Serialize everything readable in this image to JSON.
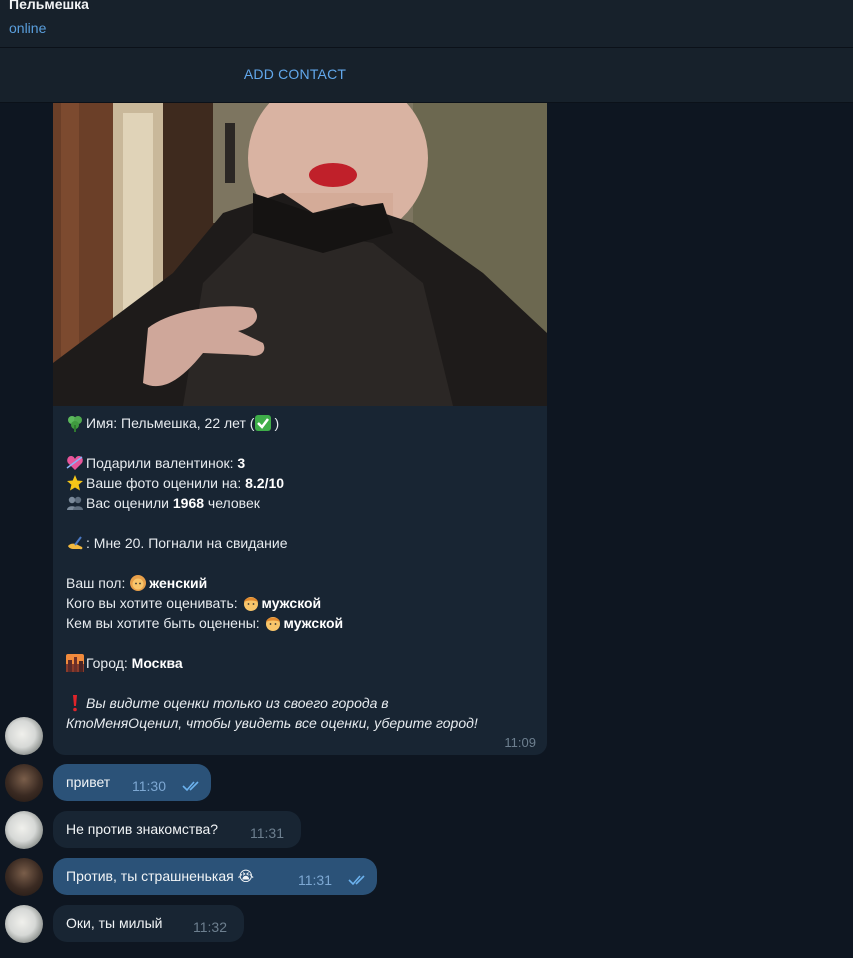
{
  "header": {
    "name": "Пельмешка",
    "status": "online"
  },
  "add_contact": "ADD CONTACT",
  "card": {
    "line_name": "Имя: Пельмешка, 22 лет (",
    "line_name_end": ")",
    "valentines_label": "Подарили валентинок: ",
    "valentines_value": "3",
    "rating_label": "Ваше фото оценили на: ",
    "rating_value": "8.2/10",
    "raters_prefix": "Вас оценили ",
    "raters_value": "1968",
    "raters_suffix": " человек",
    "bio": ": Мне 20. Погнали на свидание",
    "gender_label": "Ваш пол: ",
    "gender_value": "женский",
    "rate_whom_label": "Кого вы хотите оценивать: ",
    "rate_whom_value": "мужской",
    "rated_by_label": "Кем вы хотите быть оценены: ",
    "rated_by_value": "мужской",
    "city_label": "Город: ",
    "city_value": "Москва",
    "note_line1": "Вы видите оценки только из своего города в",
    "note_line2": "КтоМеняОценил, чтобы увидеть все оценки, уберите город!",
    "time": "11:09"
  },
  "messages": [
    {
      "text": "привет",
      "time": "11:30",
      "outgoing": true
    },
    {
      "text": "Не против знакомства?",
      "time": "11:31",
      "outgoing": false
    },
    {
      "text": "Против, ты страшненькая 😭",
      "time": "11:31",
      "outgoing": true
    },
    {
      "text": "Оки, ты милый",
      "time": "11:32",
      "outgoing": false
    }
  ],
  "icons": {
    "clover": "clover-icon",
    "check": "checkmark-icon",
    "heart": "heart-icon",
    "star": "star-icon",
    "people": "people-icon",
    "pen": "writing-hand-icon",
    "woman": "woman-icon",
    "man": "man-icon",
    "city": "city-sunset-icon",
    "exclamation": "exclamation-icon",
    "read": "double-check-icon"
  },
  "colors": {
    "background": "#0e1621",
    "panel": "#17212b",
    "incoming_bubble": "#182533",
    "outgoing_bubble": "#2b5278",
    "accent": "#62a8ec"
  }
}
